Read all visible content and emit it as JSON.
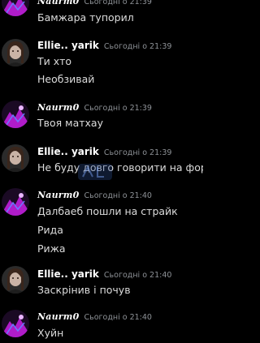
{
  "messages": [
    {
      "author": "Naurm0",
      "time": "Сьогодні о 21:39",
      "lines": [
        "Бамжара тупорил"
      ]
    },
    {
      "author": "Ellie.. yarik",
      "time": "Сьогодні о 21:39",
      "lines": [
        "Ти хто",
        "Необзивай"
      ]
    },
    {
      "author": "Naurm0",
      "time": "Сьогодні о 21:39",
      "lines": [
        "Твоя матхау"
      ]
    },
    {
      "author": "Ellie.. yarik",
      "time": "Сьогодні о 21:39",
      "lines": [
        "Не буду довго говорити на форум"
      ]
    },
    {
      "author": "Naurm0",
      "time": "Сьогодні о 21:40",
      "lines": [
        "Далбаеб пошли на страйк",
        "Рида",
        "Рижа"
      ]
    },
    {
      "author": "Ellie.. yarik",
      "time": "Сьогодні о 21:40",
      "lines": [
        "Заскрінив і почув"
      ]
    },
    {
      "author": "Naurm0",
      "time": "Сьогодні о 21:40",
      "lines": [
        "Хуйн"
      ]
    }
  ],
  "colors": {
    "background": "#000000",
    "author": "#ffffff",
    "timestamp": "#8e9297",
    "text": "#dcdcdc",
    "avatar_accent": "#b01cc9"
  }
}
